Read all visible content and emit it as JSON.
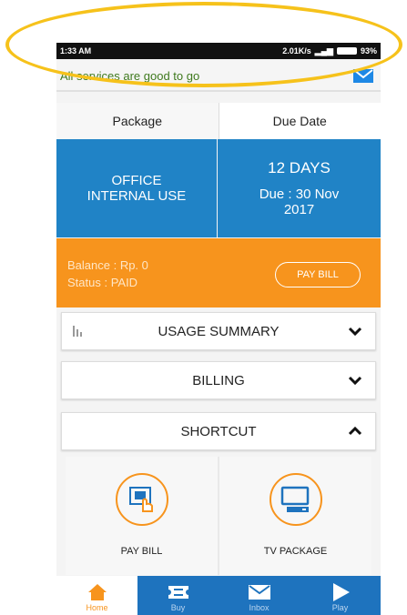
{
  "status_bar": {
    "time": "1:33 AM",
    "network_speed": "2.01K/s",
    "battery": "93%"
  },
  "notification": {
    "text": "All services are good to go",
    "icon": "mail-icon"
  },
  "table_headers": {
    "package": "Package",
    "due_date": "Due Date"
  },
  "package": {
    "name": "OFFICE INTERNAL USE"
  },
  "due": {
    "days": "12 DAYS",
    "date": "Due : 30 Nov 2017"
  },
  "billing_info": {
    "balance": "Balance : Rp. 0",
    "status": "Status : PAID",
    "pay_button": "PAY BILL"
  },
  "accordion": {
    "usage": "USAGE SUMMARY",
    "billing": "BILLING",
    "shortcut": "SHORTCUT"
  },
  "shortcuts": [
    {
      "label": "PAY BILL",
      "icon": "pay-bill-icon"
    },
    {
      "label": "TV PACKAGE",
      "icon": "tv-package-icon"
    }
  ],
  "bottom_nav": [
    {
      "label": "Home",
      "icon": "home-icon",
      "active": true
    },
    {
      "label": "Buy",
      "icon": "ticket-icon",
      "active": false
    },
    {
      "label": "Inbox",
      "icon": "envelope-icon",
      "active": false
    },
    {
      "label": "Play",
      "icon": "play-icon",
      "active": false
    }
  ],
  "colors": {
    "blue": "#2083c6",
    "orange": "#f7941d",
    "nav_blue": "#1e73be",
    "highlight": "#f6c21b",
    "notify_green": "#3f7a1e"
  }
}
